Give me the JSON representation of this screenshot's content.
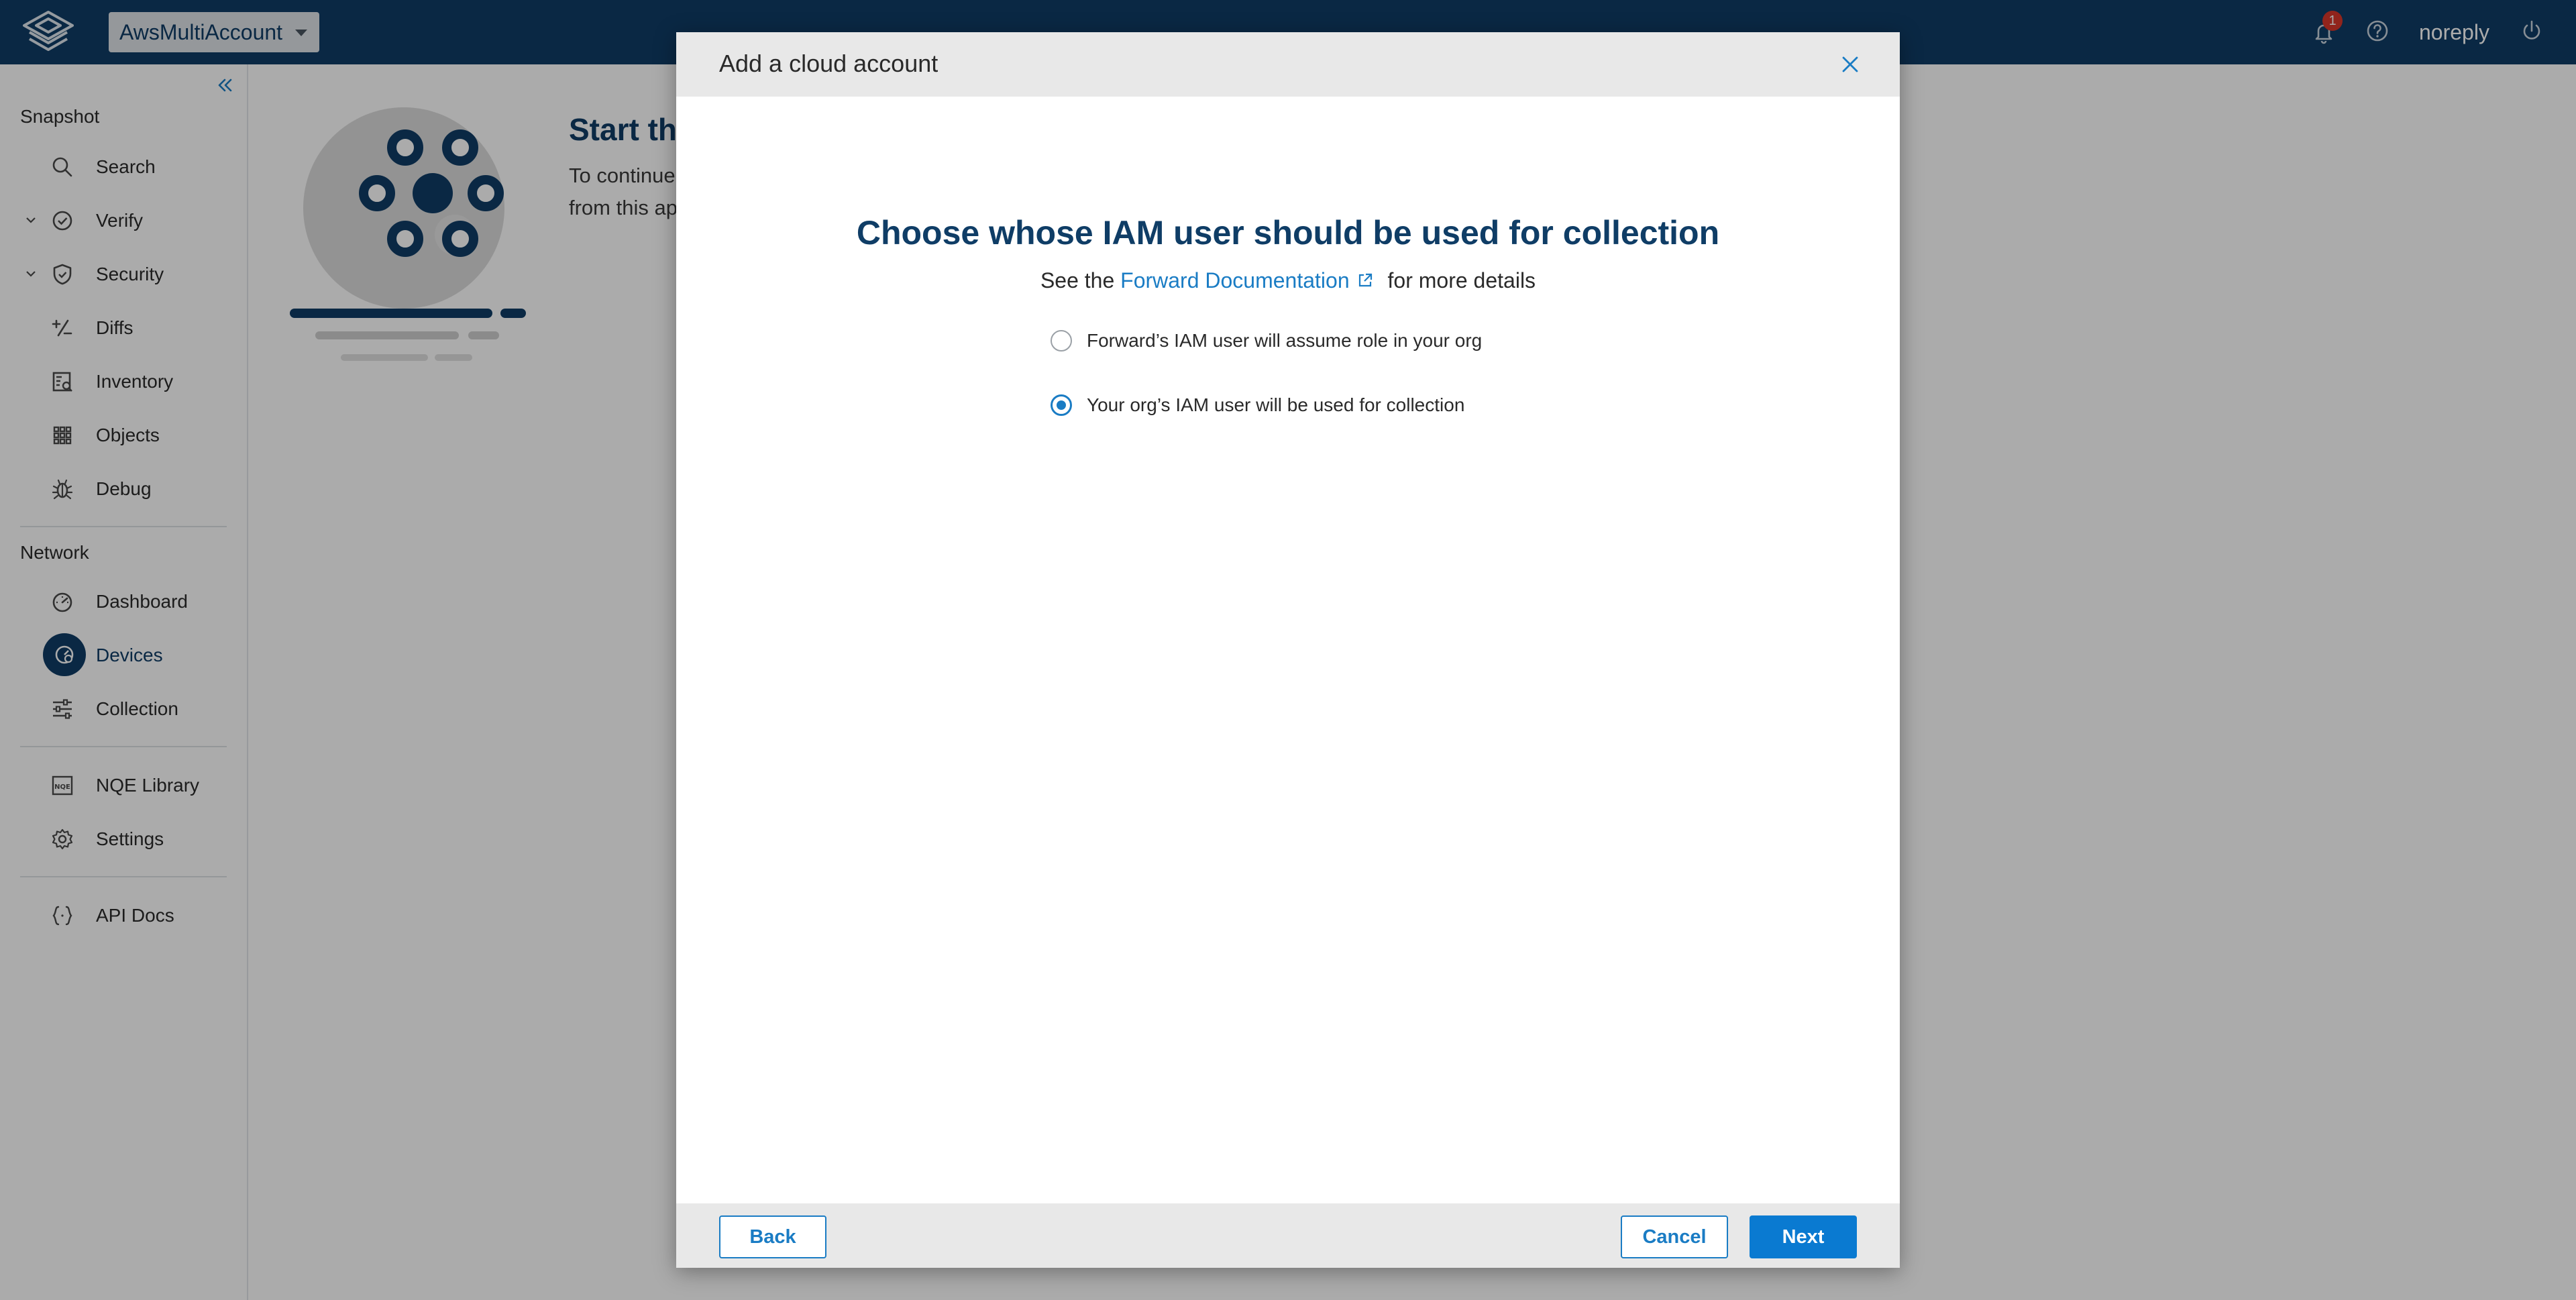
{
  "header": {
    "workspace": "AwsMultiAccount",
    "notification_count": "1",
    "user": "noreply"
  },
  "sidebar": {
    "snapshot_title": "Snapshot",
    "snapshot_items": [
      {
        "label": "Search",
        "icon": "search-icon"
      },
      {
        "label": "Verify",
        "icon": "check-circle-icon"
      },
      {
        "label": "Security",
        "icon": "shield-icon"
      },
      {
        "label": "Diffs",
        "icon": "diff-icon"
      },
      {
        "label": "Inventory",
        "icon": "inventory-icon"
      },
      {
        "label": "Objects",
        "icon": "grid-icon"
      },
      {
        "label": "Debug",
        "icon": "bug-icon"
      }
    ],
    "network_title": "Network",
    "network_items": [
      {
        "label": "Dashboard",
        "icon": "gauge-icon"
      },
      {
        "label": "Devices",
        "icon": "devices-icon",
        "active": true
      },
      {
        "label": "Collection",
        "icon": "sliders-icon"
      }
    ],
    "other_items": [
      {
        "label": "NQE Library",
        "icon": "nqe-icon"
      },
      {
        "label": "Settings",
        "icon": "gear-icon"
      },
      {
        "label": "API Docs",
        "icon": "braces-icon"
      }
    ]
  },
  "background": {
    "title": "Start th",
    "line1": "To continue",
    "line2": "from this ap"
  },
  "modal": {
    "title": "Add a cloud account",
    "heading": "Choose whose IAM user should be used for collection",
    "sub_prefix": "See the ",
    "sub_link": "Forward Documentation",
    "sub_suffix": " for more details",
    "options": [
      {
        "label": "Forward’s IAM user will assume role in your org",
        "selected": false
      },
      {
        "label": "Your org’s IAM user will be used for collection",
        "selected": true
      }
    ],
    "back_label": "Back",
    "cancel_label": "Cancel",
    "next_label": "Next"
  },
  "colors": {
    "brand": "#0f3d66",
    "accent": "#1a7cc4",
    "primary_button": "#0a7ad1",
    "badge": "#d8362b"
  }
}
